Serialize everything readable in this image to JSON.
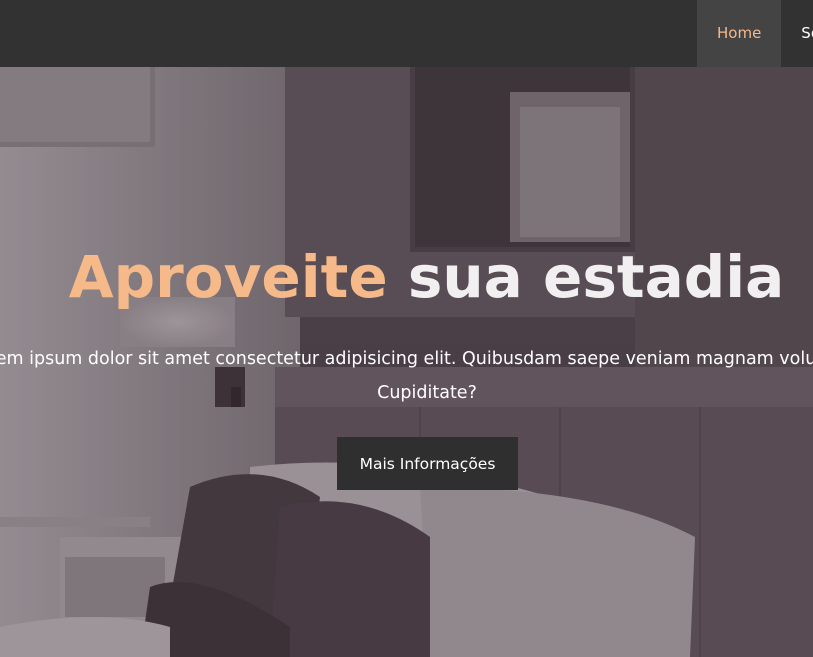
{
  "nav": {
    "items": [
      {
        "label": "Home",
        "active": true
      },
      {
        "label": "Sobre",
        "active": false
      }
    ]
  },
  "hero": {
    "title_accent": "Aproveite",
    "title_rest": " sua estadia",
    "text_line1": "Lorem ipsum dolor sit amet consectetur adipisicing elit. Quibusdam saepe veniam magnam voluptatem.",
    "text_line2": "Cupiditate?",
    "button_label": "Mais Informações",
    "background": "hotel-bedroom-photo"
  },
  "colors": {
    "accent": "#f5b98a",
    "navbar": "#323232",
    "nav_active_bg": "#444444",
    "button_bg": "#2f2f2f"
  }
}
